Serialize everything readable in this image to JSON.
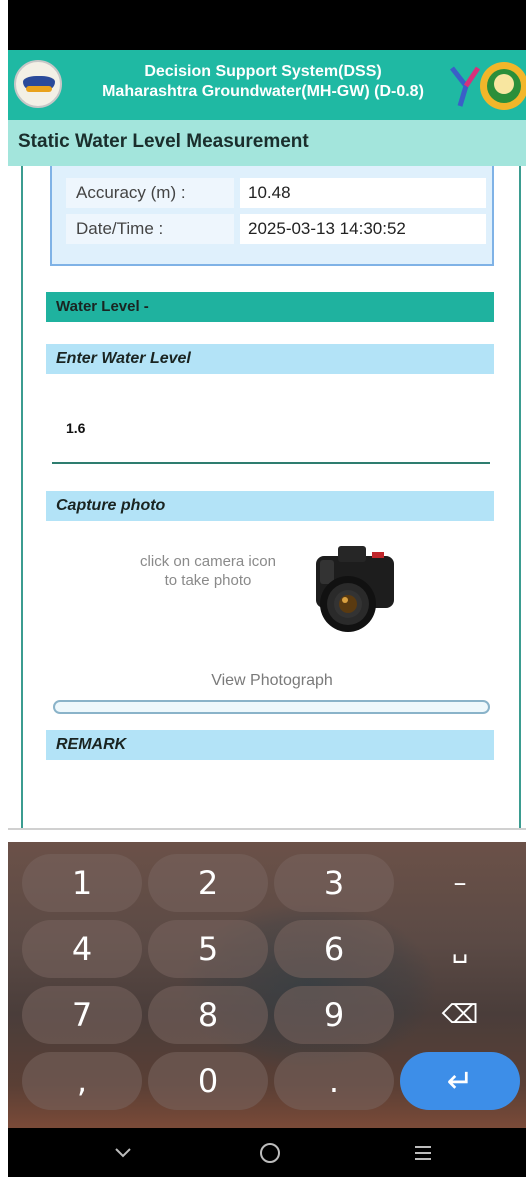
{
  "app": {
    "title_line1": "Decision Support System(DSS)",
    "title_line2": "Maharashtra Groundwater(MH-GW) (D-0.8)",
    "subtitle": "Static Water Level Measurement"
  },
  "gps": {
    "rows": [
      {
        "label": "Accuracy (m) :",
        "value": "10.48"
      },
      {
        "label": "Date/Time :",
        "value": "2025-03-13 14:30:52"
      }
    ]
  },
  "water_level": {
    "section_title": "Water Level -",
    "enter_label": "Enter Water Level",
    "value": "1.6"
  },
  "photo": {
    "section_title": "Capture photo",
    "hint": "click on camera icon to take photo",
    "view_label": "View Photograph",
    "progress_fraction": 0
  },
  "remark": {
    "section_title": "REMARK"
  },
  "keyboard": {
    "keys": [
      [
        "1",
        "2",
        "3",
        "–"
      ],
      [
        "4",
        "5",
        "6",
        "␣"
      ],
      [
        "7",
        "8",
        "9",
        "⌫"
      ],
      [
        ",",
        "0",
        ".",
        "↵"
      ]
    ]
  },
  "navbar": {
    "back_icon": "chevron-down-icon",
    "home_icon": "home-circle-icon",
    "menu_icon": "menu-lines-icon"
  },
  "colors": {
    "teal": "#1fb9a3",
    "light_teal": "#a3e5dc",
    "light_blue": "#b3e3f7",
    "enter_key": "#3d8ee8"
  }
}
